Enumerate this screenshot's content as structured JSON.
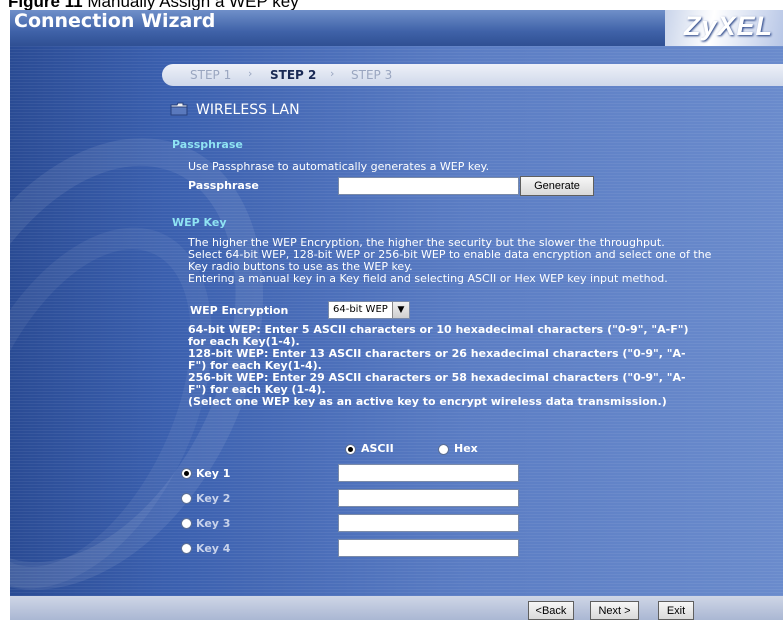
{
  "caption": {
    "figure": "Figure 11",
    "text": "Manually Assign a WEP key"
  },
  "window": {
    "title": "Connection Wizard",
    "logo": "ZyXEL"
  },
  "steps": [
    {
      "label": "STEP 1",
      "state": "done"
    },
    {
      "label": "STEP 2",
      "state": "active"
    },
    {
      "label": "STEP 3",
      "state": "pending"
    }
  ],
  "step_separator": "›",
  "section": {
    "title": "WIRELESS LAN"
  },
  "passphrase": {
    "heading": "Passphrase",
    "description": "Use Passphrase to automatically generates a WEP key.",
    "label": "Passphrase",
    "value": "",
    "generate_label": "Generate"
  },
  "wep": {
    "heading": "WEP Key",
    "desc": [
      "The higher the WEP Encryption, the higher the security but the slower the throughput.",
      "Select 64-bit WEP, 128-bit WEP or 256-bit WEP to enable data encryption and select one of the",
      "Key radio buttons to use as the WEP key.",
      "Entering a manual key in a Key field and selecting ASCII or Hex WEP key input method."
    ],
    "encryption_label": "WEP Encryption",
    "encryption_value": "64-bit WEP",
    "notes": [
      "64-bit WEP: Enter 5 ASCII characters or 10 hexadecimal characters (\"0-9\", \"A-F\")",
      "for each Key(1-4).",
      "128-bit WEP: Enter 13 ASCII characters or 26 hexadecimal characters (\"0-9\", \"A-",
      "F\") for each Key(1-4).",
      "256-bit WEP: Enter 29 ASCII characters or 58 hexadecimal characters (\"0-9\", \"A-",
      "F\") for each Key (1-4).",
      "(Select one WEP key as an active key to encrypt wireless data transmission.)"
    ],
    "input_method": {
      "ascii": "ASCII",
      "hex": "Hex",
      "selected": "ascii"
    },
    "keys": [
      {
        "label": "Key 1",
        "value": "",
        "selected": true
      },
      {
        "label": "Key 2",
        "value": "",
        "selected": false
      },
      {
        "label": "Key 3",
        "value": "",
        "selected": false
      },
      {
        "label": "Key 4",
        "value": "",
        "selected": false
      }
    ]
  },
  "footer": {
    "back_label": "<Back",
    "next_label": "Next >",
    "exit_label": "Exit"
  }
}
